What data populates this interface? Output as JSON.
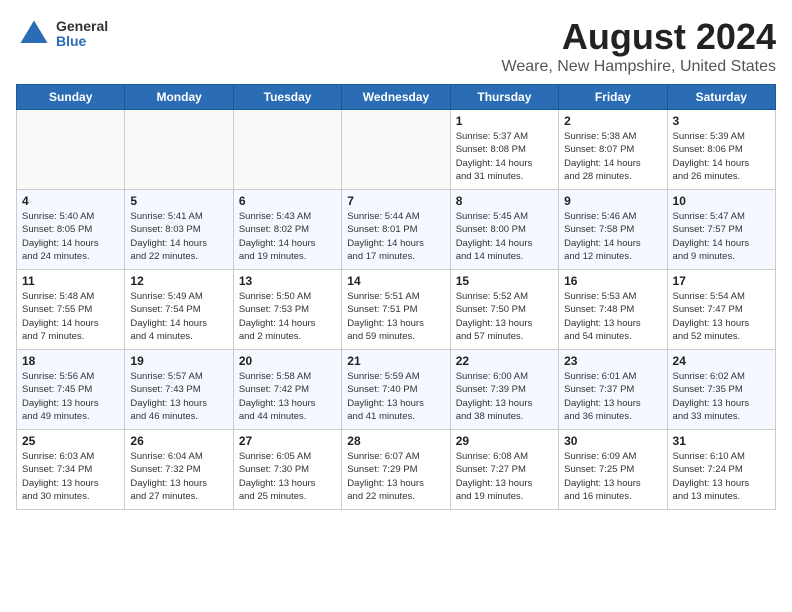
{
  "header": {
    "logo_general": "General",
    "logo_blue": "Blue",
    "title": "August 2024",
    "subtitle": "Weare, New Hampshire, United States"
  },
  "weekdays": [
    "Sunday",
    "Monday",
    "Tuesday",
    "Wednesday",
    "Thursday",
    "Friday",
    "Saturday"
  ],
  "weeks": [
    [
      {
        "day": "",
        "info": ""
      },
      {
        "day": "",
        "info": ""
      },
      {
        "day": "",
        "info": ""
      },
      {
        "day": "",
        "info": ""
      },
      {
        "day": "1",
        "info": "Sunrise: 5:37 AM\nSunset: 8:08 PM\nDaylight: 14 hours\nand 31 minutes."
      },
      {
        "day": "2",
        "info": "Sunrise: 5:38 AM\nSunset: 8:07 PM\nDaylight: 14 hours\nand 28 minutes."
      },
      {
        "day": "3",
        "info": "Sunrise: 5:39 AM\nSunset: 8:06 PM\nDaylight: 14 hours\nand 26 minutes."
      }
    ],
    [
      {
        "day": "4",
        "info": "Sunrise: 5:40 AM\nSunset: 8:05 PM\nDaylight: 14 hours\nand 24 minutes."
      },
      {
        "day": "5",
        "info": "Sunrise: 5:41 AM\nSunset: 8:03 PM\nDaylight: 14 hours\nand 22 minutes."
      },
      {
        "day": "6",
        "info": "Sunrise: 5:43 AM\nSunset: 8:02 PM\nDaylight: 14 hours\nand 19 minutes."
      },
      {
        "day": "7",
        "info": "Sunrise: 5:44 AM\nSunset: 8:01 PM\nDaylight: 14 hours\nand 17 minutes."
      },
      {
        "day": "8",
        "info": "Sunrise: 5:45 AM\nSunset: 8:00 PM\nDaylight: 14 hours\nand 14 minutes."
      },
      {
        "day": "9",
        "info": "Sunrise: 5:46 AM\nSunset: 7:58 PM\nDaylight: 14 hours\nand 12 minutes."
      },
      {
        "day": "10",
        "info": "Sunrise: 5:47 AM\nSunset: 7:57 PM\nDaylight: 14 hours\nand 9 minutes."
      }
    ],
    [
      {
        "day": "11",
        "info": "Sunrise: 5:48 AM\nSunset: 7:55 PM\nDaylight: 14 hours\nand 7 minutes."
      },
      {
        "day": "12",
        "info": "Sunrise: 5:49 AM\nSunset: 7:54 PM\nDaylight: 14 hours\nand 4 minutes."
      },
      {
        "day": "13",
        "info": "Sunrise: 5:50 AM\nSunset: 7:53 PM\nDaylight: 14 hours\nand 2 minutes."
      },
      {
        "day": "14",
        "info": "Sunrise: 5:51 AM\nSunset: 7:51 PM\nDaylight: 13 hours\nand 59 minutes."
      },
      {
        "day": "15",
        "info": "Sunrise: 5:52 AM\nSunset: 7:50 PM\nDaylight: 13 hours\nand 57 minutes."
      },
      {
        "day": "16",
        "info": "Sunrise: 5:53 AM\nSunset: 7:48 PM\nDaylight: 13 hours\nand 54 minutes."
      },
      {
        "day": "17",
        "info": "Sunrise: 5:54 AM\nSunset: 7:47 PM\nDaylight: 13 hours\nand 52 minutes."
      }
    ],
    [
      {
        "day": "18",
        "info": "Sunrise: 5:56 AM\nSunset: 7:45 PM\nDaylight: 13 hours\nand 49 minutes."
      },
      {
        "day": "19",
        "info": "Sunrise: 5:57 AM\nSunset: 7:43 PM\nDaylight: 13 hours\nand 46 minutes."
      },
      {
        "day": "20",
        "info": "Sunrise: 5:58 AM\nSunset: 7:42 PM\nDaylight: 13 hours\nand 44 minutes."
      },
      {
        "day": "21",
        "info": "Sunrise: 5:59 AM\nSunset: 7:40 PM\nDaylight: 13 hours\nand 41 minutes."
      },
      {
        "day": "22",
        "info": "Sunrise: 6:00 AM\nSunset: 7:39 PM\nDaylight: 13 hours\nand 38 minutes."
      },
      {
        "day": "23",
        "info": "Sunrise: 6:01 AM\nSunset: 7:37 PM\nDaylight: 13 hours\nand 36 minutes."
      },
      {
        "day": "24",
        "info": "Sunrise: 6:02 AM\nSunset: 7:35 PM\nDaylight: 13 hours\nand 33 minutes."
      }
    ],
    [
      {
        "day": "25",
        "info": "Sunrise: 6:03 AM\nSunset: 7:34 PM\nDaylight: 13 hours\nand 30 minutes."
      },
      {
        "day": "26",
        "info": "Sunrise: 6:04 AM\nSunset: 7:32 PM\nDaylight: 13 hours\nand 27 minutes."
      },
      {
        "day": "27",
        "info": "Sunrise: 6:05 AM\nSunset: 7:30 PM\nDaylight: 13 hours\nand 25 minutes."
      },
      {
        "day": "28",
        "info": "Sunrise: 6:07 AM\nSunset: 7:29 PM\nDaylight: 13 hours\nand 22 minutes."
      },
      {
        "day": "29",
        "info": "Sunrise: 6:08 AM\nSunset: 7:27 PM\nDaylight: 13 hours\nand 19 minutes."
      },
      {
        "day": "30",
        "info": "Sunrise: 6:09 AM\nSunset: 7:25 PM\nDaylight: 13 hours\nand 16 minutes."
      },
      {
        "day": "31",
        "info": "Sunrise: 6:10 AM\nSunset: 7:24 PM\nDaylight: 13 hours\nand 13 minutes."
      }
    ]
  ]
}
